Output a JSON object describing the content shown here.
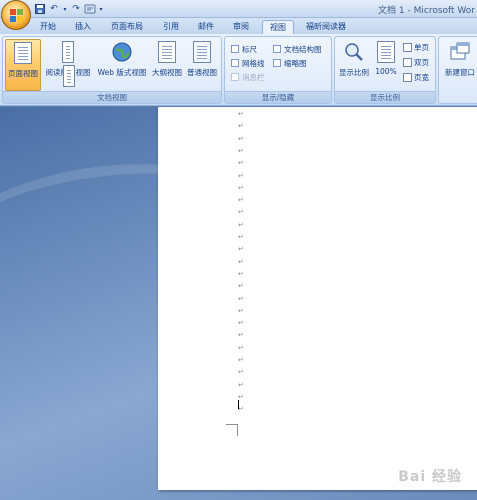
{
  "window": {
    "title": "文档 1 - Microsoft Wor"
  },
  "tabs": [
    {
      "label": "开始"
    },
    {
      "label": "插入"
    },
    {
      "label": "页面布局"
    },
    {
      "label": "引用"
    },
    {
      "label": "邮件"
    },
    {
      "label": "审阅"
    },
    {
      "label": "视图"
    },
    {
      "label": "福昕阅读器"
    }
  ],
  "active_tab": "视图",
  "ribbon": {
    "doc_views": {
      "label": "文档视图",
      "buttons": [
        {
          "label": "页面视图",
          "icon": "page-view-icon"
        },
        {
          "label": "阅读版式视图",
          "icon": "reading-layout-icon"
        },
        {
          "label": "Web 版式视图",
          "icon": "web-layout-icon"
        },
        {
          "label": "大纲视图",
          "icon": "outline-view-icon"
        },
        {
          "label": "普通视图",
          "icon": "draft-view-icon"
        }
      ]
    },
    "show_hide": {
      "label": "显示/隐藏",
      "options": [
        {
          "label": "标尺"
        },
        {
          "label": "文档结构图"
        },
        {
          "label": "网格线"
        },
        {
          "label": "缩略图"
        },
        {
          "label": "消息栏"
        }
      ]
    },
    "zoom": {
      "label": "显示比例",
      "zoom_label": "显示比例",
      "pct_label": "100%",
      "one_page": "单页",
      "two_pages": "双页",
      "page_width": "页宽"
    },
    "window": {
      "new_window": "新建窗口"
    }
  },
  "watermark": "Bai 经验"
}
